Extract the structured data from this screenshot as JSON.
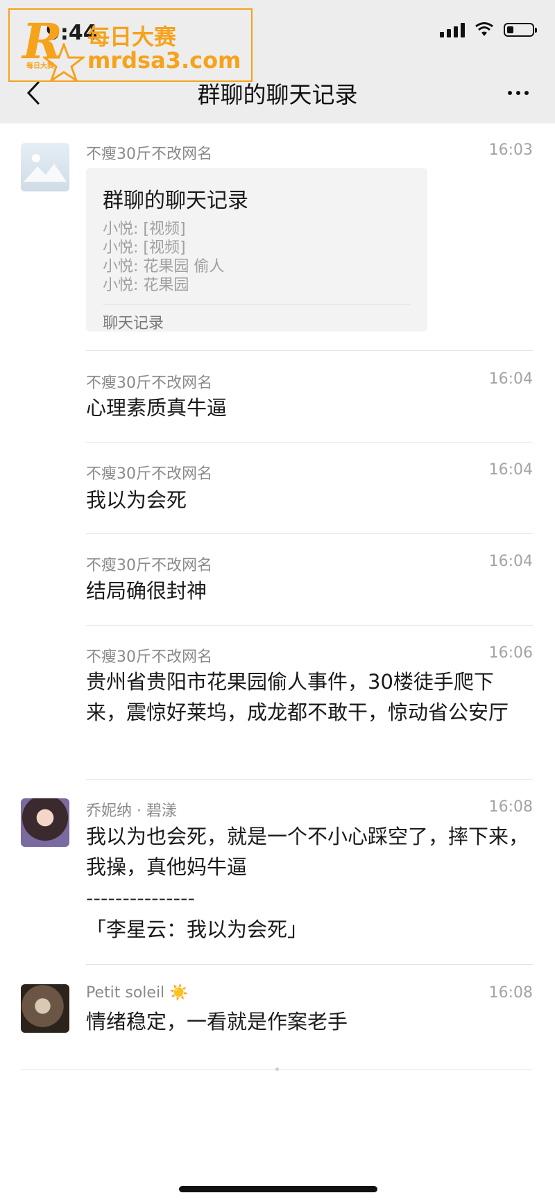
{
  "status_bar": {
    "time": "9:44",
    "battery_level": 0.25
  },
  "nav": {
    "title": "群聊的聊天记录",
    "back_icon": "chevron-left-icon",
    "more_icon": "more-horizontal-icon"
  },
  "watermark": {
    "letter": "R",
    "small": "每日大赛",
    "cn": "每日大赛",
    "url": "mrdsa3.com"
  },
  "messages": [
    {
      "sender": "不瘦30斤不改网名",
      "time": "16:03",
      "card": {
        "title": "群聊的聊天记录",
        "lines": [
          "小悦: [视频]",
          "小悦: [视频]",
          "小悦: 花果园 偷人",
          "小悦: 花果园"
        ],
        "footer": "聊天记录"
      }
    },
    {
      "sender": "不瘦30斤不改网名",
      "time": "16:04",
      "text": "心理素质真牛逼"
    },
    {
      "sender": "不瘦30斤不改网名",
      "time": "16:04",
      "text": "我以为会死"
    },
    {
      "sender": "不瘦30斤不改网名",
      "time": "16:04",
      "text": "结局确很封神"
    },
    {
      "sender": "不瘦30斤不改网名",
      "time": "16:06",
      "text": "贵州省贵阳市花果园偷人事件，30楼徒手爬下来，震惊好莱坞，成龙都不敢干，惊动省公安厅"
    },
    {
      "sender": "乔妮纳 · 碧漾",
      "time": "16:08",
      "text": "我以为也会死，就是一个不小心踩空了，摔下来，我操，真他妈牛逼",
      "quote_sep": "---------------",
      "quote": "「李星云：我以为会死」"
    },
    {
      "sender": "Petit soleil",
      "sender_emoji": "☀️",
      "time": "16:08",
      "text": "情绪稳定，一看就是作案老手"
    }
  ]
}
